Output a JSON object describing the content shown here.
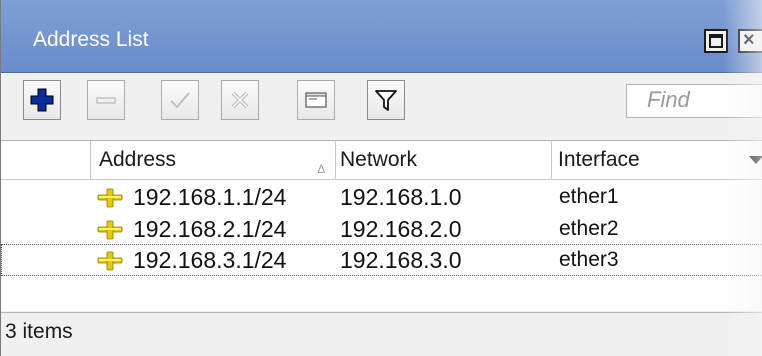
{
  "window": {
    "title": "Address List",
    "colors": {
      "titlebar": "#7395d0",
      "title_text": "#ffffff"
    }
  },
  "toolbar": {
    "add_icon": "plus-icon",
    "remove_icon": "minus-icon",
    "enable_icon": "check-icon",
    "disable_icon": "x-icon",
    "comment_icon": "comment-icon",
    "filter_icon": "filter-icon",
    "find_placeholder": "Find",
    "add_color": "#0a2f9c"
  },
  "table": {
    "columns": [
      "Address",
      "Network",
      "Interface"
    ],
    "rows": [
      {
        "address": "192.168.1.1/24",
        "network": "192.168.1.0",
        "interface": "ether1",
        "icon": "address-icon"
      },
      {
        "address": "192.168.2.1/24",
        "network": "192.168.2.0",
        "interface": "ether2",
        "icon": "address-icon"
      },
      {
        "address": "192.168.3.1/24",
        "network": "192.168.3.0",
        "interface": "ether3",
        "icon": "address-icon"
      }
    ]
  },
  "status": {
    "count": "3 items"
  }
}
